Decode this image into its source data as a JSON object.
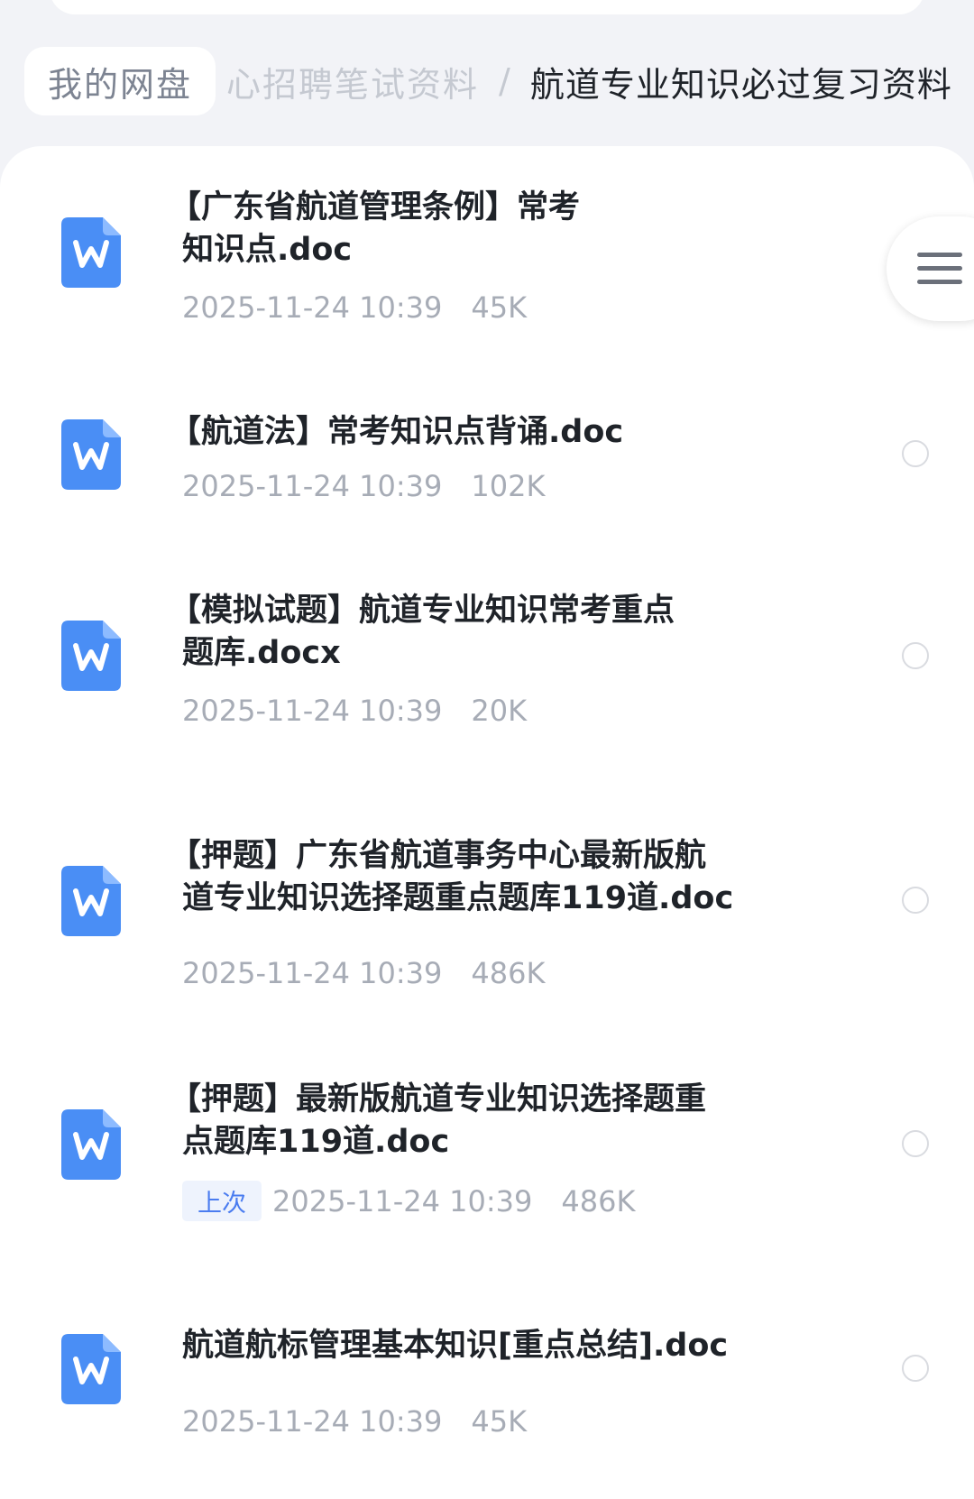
{
  "breadcrumb": {
    "root": "我的网盘",
    "middle": "心招聘笔试资料",
    "separator": "/",
    "current": "航道专业知识必过复习资料"
  },
  "files": [
    {
      "title_line1": "【广东省航道管理条例】常考",
      "title_line2": "知识点.doc",
      "date": "2025-11-24 10:39",
      "size": "45K",
      "icon": "word-doc-icon"
    },
    {
      "title_line1": "【航道法】常考知识点背诵.doc",
      "title_line2": "",
      "date": "2025-11-24 10:39",
      "size": "102K",
      "icon": "word-doc-icon"
    },
    {
      "title_line1": "【模拟试题】航道专业知识常考重点",
      "title_line2": "题库.docx",
      "date": "2025-11-24 10:39",
      "size": "20K",
      "icon": "word-doc-icon"
    },
    {
      "title_line1": "【押题】广东省航道事务中心最新版航",
      "title_line2": "道专业知识选择题重点题库119道.doc",
      "date": "2025-11-24 10:39",
      "size": "486K",
      "icon": "word-doc-icon"
    },
    {
      "title_line1": "【押题】最新版航道专业知识选择题重",
      "title_line2": "点题库119道.doc",
      "tag": "上次",
      "date": "2025-11-24 10:39",
      "size": "486K",
      "icon": "word-doc-icon"
    },
    {
      "title_line1": "航道航标管理基本知识[重点总结].doc",
      "title_line2": "",
      "date": "2025-11-24 10:39",
      "size": "45K",
      "icon": "word-doc-icon"
    }
  ],
  "menu_button": {
    "icon": "hamburger-menu-icon"
  },
  "colors": {
    "icon_blue": "#4a8ef5",
    "text_dark": "#1f2329",
    "meta_gray": "#a7acb6",
    "tag_blue": "#4a7cf0"
  }
}
